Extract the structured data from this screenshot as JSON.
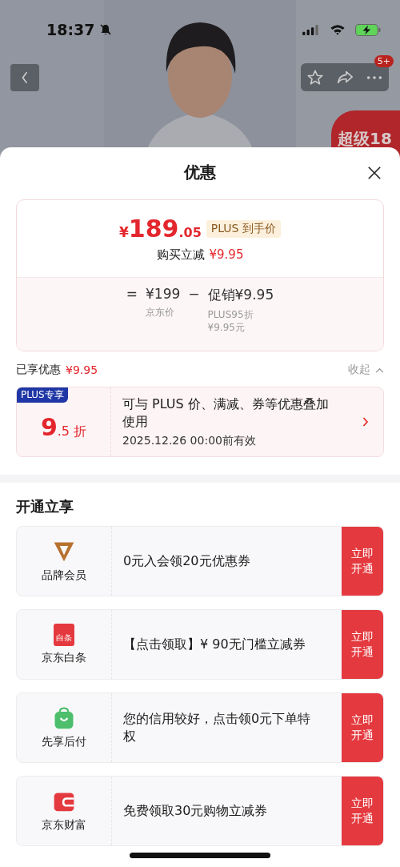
{
  "status_bar": {
    "time": "18:37"
  },
  "header": {
    "badge": "5+",
    "promo_tag": "超级18"
  },
  "sheet": {
    "title": "优惠",
    "price_card": {
      "currency": "¥",
      "price_int": "189",
      "price_dec": ".05",
      "price_tag": "PLUS 到手价",
      "reduction_label": "购买立减",
      "reduction_value": "¥9.95",
      "equation": [
        {
          "kind": "op",
          "text": "="
        },
        {
          "kind": "term",
          "value": "¥199",
          "caption": [
            "京东价"
          ]
        },
        {
          "kind": "op",
          "text": "−"
        },
        {
          "kind": "term",
          "value": "促销¥9.95",
          "caption": [
            "PLUS95折",
            "¥9.95元"
          ]
        }
      ]
    },
    "enjoyed": {
      "label": "已享优惠",
      "value": "¥9.95",
      "toggle": "收起",
      "expanded": true
    },
    "coupon": {
      "tag": "PLUS专享",
      "discount_int": "9",
      "discount_dec": ".5",
      "discount_unit": "折",
      "description": "可与 PLUS 价、满减、券等优惠叠加使用",
      "validity": "2025.12.26 00:00前有效"
    },
    "section_title": "开通立享",
    "offers": [
      {
        "kind": "brand",
        "name": "品牌会员",
        "text": "0元入会领20元优惠券",
        "action": "立即开通"
      },
      {
        "kind": "baitiao",
        "icon_text": "白条",
        "name": "京东白条",
        "text": "【点击领取】¥ 90无门槛立减券",
        "action": "立即开通"
      },
      {
        "kind": "bag",
        "name": "先享后付",
        "text": "您的信用较好，点击领0元下单特权",
        "action": "立即开通"
      },
      {
        "kind": "wallet",
        "name": "京东财富",
        "text": "免费领取30元购物立减券",
        "action": "立即开通"
      }
    ]
  }
}
